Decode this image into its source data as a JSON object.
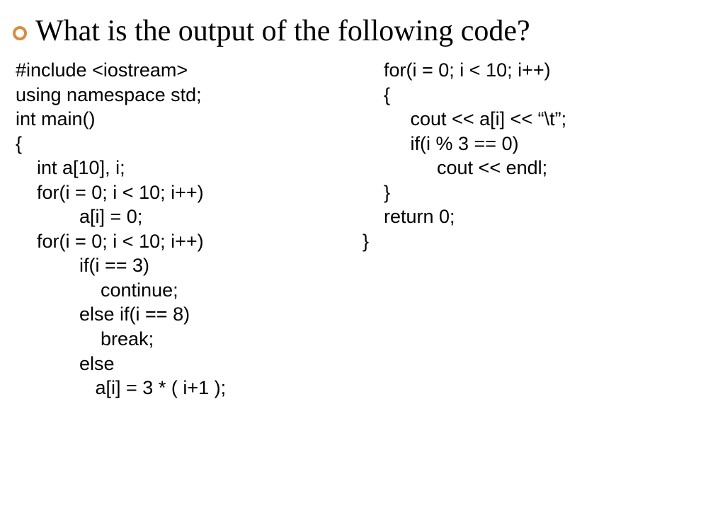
{
  "heading": "What is the output of the following code?",
  "code": {
    "left": "#include <iostream>\nusing namespace std;\nint main()\n{\n    int a[10], i;\n    for(i = 0; i < 10; i++)\n            a[i] = 0;\n    for(i = 0; i < 10; i++)\n            if(i == 3)\n                continue;\n            else if(i == 8)\n                break;\n            else\n               a[i] = 3 * ( i+1 );",
    "right": "    for(i = 0; i < 10; i++)\n    {\n         cout << a[i] << “\\t”;\n         if(i % 3 == 0)\n              cout << endl;\n    }\n    return 0;\n}"
  }
}
